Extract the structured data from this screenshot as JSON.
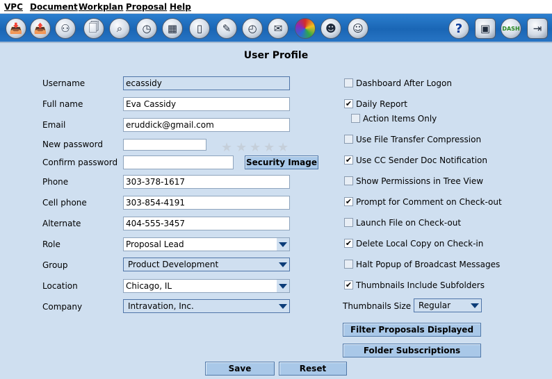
{
  "menu": [
    "VPC",
    "Document",
    "Workplan",
    "Proposal",
    "Help"
  ],
  "toolbar": {
    "left_icons": [
      "inbox-icon",
      "outbox-icon",
      "binoculars-icon",
      "documents-icon",
      "search-icon",
      "clock-icon",
      "calendar-icon",
      "bookmark-icon",
      "notepad-icon",
      "stopwatch-icon",
      "mail-icon",
      "color-palette-icon",
      "users-icon",
      "user-profile-icon"
    ],
    "right_icons": [
      "help-icon",
      "projector-icon",
      "dashboard-icon",
      "exit-icon"
    ],
    "dash_label": "DASH",
    "help_label": "?"
  },
  "page_title": "User Profile",
  "form": {
    "username_label": "Username",
    "username_value": "ecassidy",
    "fullname_label": "Full name",
    "fullname_value": "Eva Cassidy",
    "email_label": "Email",
    "email_value": "eruddick@gmail.com",
    "new_password_label": "New password",
    "confirm_password_label": "Confirm password",
    "security_image_button": "Security Image",
    "password_strength_stars": 5,
    "phone_label": "Phone",
    "phone_value": "303-378-1617",
    "cell_label": "Cell phone",
    "cell_value": "303-854-4191",
    "alternate_label": "Alternate",
    "alternate_value": "404-555-3457",
    "role_label": "Role",
    "role_value": "Proposal Lead",
    "group_label": "Group",
    "group_value": "Product Development",
    "location_label": "Location",
    "location_value": "Chicago, IL",
    "company_label": "Company",
    "company_value": "Intravation, Inc."
  },
  "options": [
    {
      "label": "Dashboard After Logon",
      "checked": false
    },
    {
      "label": "Daily Report",
      "checked": true
    },
    {
      "label": "Action Items Only",
      "checked": false
    },
    {
      "label": "Use File Transfer Compression",
      "checked": false
    },
    {
      "label": "Use CC Sender Doc Notification",
      "checked": true
    },
    {
      "label": "Show Permissions in Tree View",
      "checked": false
    },
    {
      "label": "Prompt for Comment on Check-out",
      "checked": true
    },
    {
      "label": "Launch File on Check-out",
      "checked": false
    },
    {
      "label": "Delete Local Copy on Check-in",
      "checked": true
    },
    {
      "label": "Halt Popup of Broadcast Messages",
      "checked": false
    },
    {
      "label": "Thumbnails Include Subfolders",
      "checked": true
    }
  ],
  "thumbnails_size_label": "Thumbnails Size",
  "thumbnails_size_value": "Regular",
  "filter_proposals_button": "Filter Proposals Displayed",
  "folder_subscriptions_button": "Folder Subscriptions",
  "save_button": "Save",
  "reset_button": "Reset"
}
